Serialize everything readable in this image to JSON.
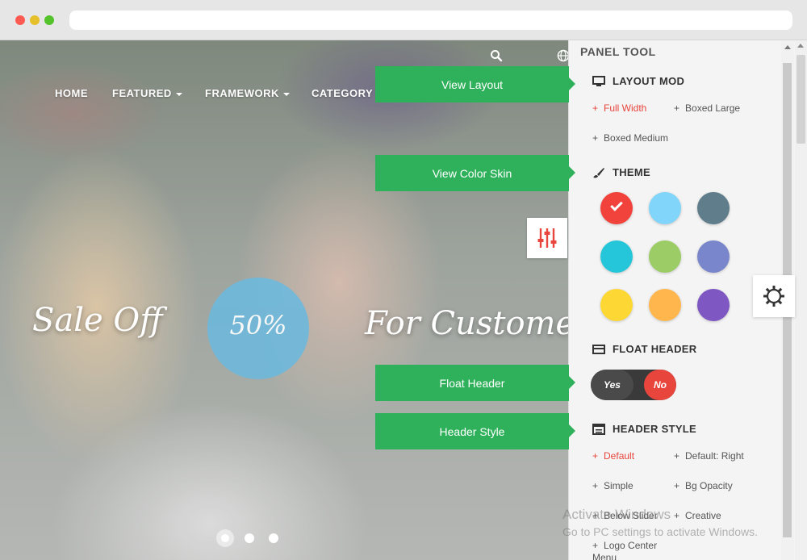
{
  "nav": {
    "items": [
      {
        "label": "HOME",
        "dropdown": false
      },
      {
        "label": "FEATURED",
        "dropdown": true
      },
      {
        "label": "FRAMEWORK",
        "dropdown": true
      },
      {
        "label": "CATEGORY",
        "dropdown": false
      }
    ],
    "icons": [
      "search-icon",
      "globe-icon"
    ]
  },
  "hero": {
    "text_left": "Sale Off",
    "circle_text": "50%",
    "text_right": "For Customer",
    "slides": 3,
    "active_slide": 1
  },
  "callouts": {
    "view_layout": "View Layout",
    "view_color_skin": "View Color Skin",
    "float_header": "Float Header",
    "header_style": "Header Style"
  },
  "panel": {
    "title": "PANEL TOOL",
    "layout": {
      "heading": "LAYOUT MOD",
      "options": [
        "Full Width",
        "Boxed Large",
        "Boxed Medium"
      ],
      "active": "Full Width"
    },
    "theme": {
      "heading": "THEME",
      "colors": [
        "#f1423b",
        "#81d4fa",
        "#607d8b",
        "#26c6da",
        "#9ccc65",
        "#7986cb",
        "#fdd835",
        "#ffb74d",
        "#7e57c2"
      ],
      "selected_index": 0
    },
    "float_header": {
      "heading": "FLOAT HEADER",
      "yes": "Yes",
      "no": "No",
      "value": "No"
    },
    "header_style": {
      "heading": "HEADER STYLE",
      "options": [
        "Default",
        "Default: Right",
        "Simple",
        "Bg Opacity",
        "Below Slider",
        "Creative",
        "Logo Center",
        "Menu"
      ],
      "active": "Default"
    }
  },
  "watermark": {
    "line1": "Activate Windows",
    "line2": "Go to PC settings to activate Windows."
  },
  "colors": {
    "accent_green": "#2fb15b",
    "accent_red": "#e8453c",
    "circle_blue": "#6fb8db"
  }
}
